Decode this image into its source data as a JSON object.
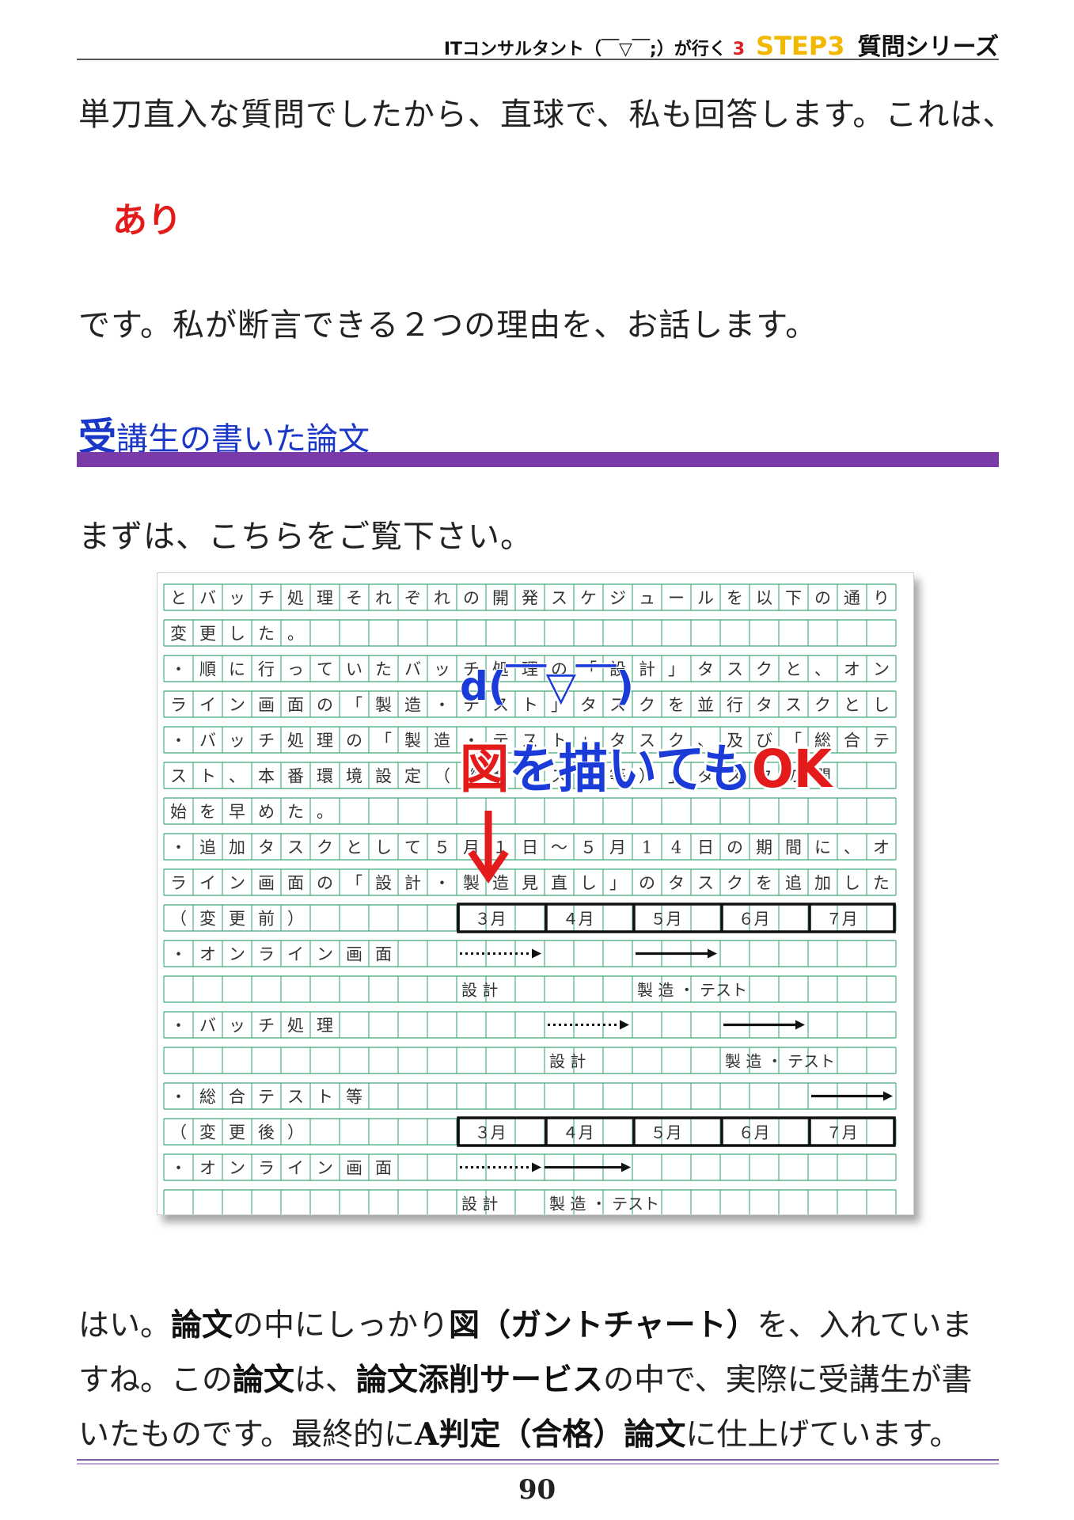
{
  "header": {
    "series": "ITコンサルタント（￣▽￣;）が行く",
    "number": "3",
    "step": "STEP3",
    "subtitle": "質問シリーズ"
  },
  "intro_line": "単刀直入な質問でしたから、直球で、私も回答します。これは、",
  "answer_word": "あり",
  "reason_line": "です。私が断言できる２つの理由を、お話します。",
  "section": {
    "first_char": "受",
    "rest": "講生の書いた論文"
  },
  "lead_line": "まずは、こちらをご覧下さい。",
  "manuscript": {
    "rows": [
      "とバッチ処理それぞれの開発スケジュールを以下の通り",
      "変更した。",
      "・順に行っていたバッチ処理の「設計」タスクと、オン",
      "ライン画面の「製造・テスト」タスクを並行タスクとした。",
      "・バッチ処理の「製造・テスト」タスク、及び「総合テ",
      "スト、本番環境設定（総合テスト等）」タスクの開",
      "始を早めた。",
      "・追加タスクとして５月１日～５月14日の期間に、オン",
      "ライン画面の「設計・製造見直し」のタスクを追加した。"
    ],
    "gantt_rows": [
      "（変更前）",
      "・オンライン画面",
      "",
      "・バッチ処理",
      "",
      "・総合テスト等",
      "（変更後）",
      "・オンライン画面",
      ""
    ],
    "months": [
      "３月",
      "４月",
      "５月",
      "６月",
      "７月"
    ],
    "gantt_labels": {
      "design": "設 計",
      "build_test": "製 造 ・ テスト"
    },
    "overlay": {
      "face": "d(￣▽￣)",
      "caption": "図を描いてもOK"
    }
  },
  "closing_lines": [
    [
      {
        "t": "はい。"
      },
      {
        "t": "論文",
        "b": true
      },
      {
        "t": "の中にしっかり"
      },
      {
        "t": "図（ガントチャート）",
        "b": true
      },
      {
        "t": "を、入れていま"
      }
    ],
    [
      {
        "t": "すね。この"
      },
      {
        "t": "論文",
        "b": true
      },
      {
        "t": "は、"
      },
      {
        "t": "論文添削サービス",
        "b": true
      },
      {
        "t": "の中で、実際に受講生が書"
      }
    ],
    [
      {
        "t": "いたものです。最終的に"
      },
      {
        "t": "A判定（合格）",
        "b": true
      },
      {
        "t": "論文",
        "b": true
      },
      {
        "t": "に仕上げています。"
      }
    ]
  ],
  "page_number": "90",
  "colors": {
    "accent_purple": "#7a3aa8",
    "heading_blue": "#1a37c8",
    "red": "#e41b1b",
    "step_yellow": "#f2b800",
    "grid_green": "#3fa877"
  }
}
